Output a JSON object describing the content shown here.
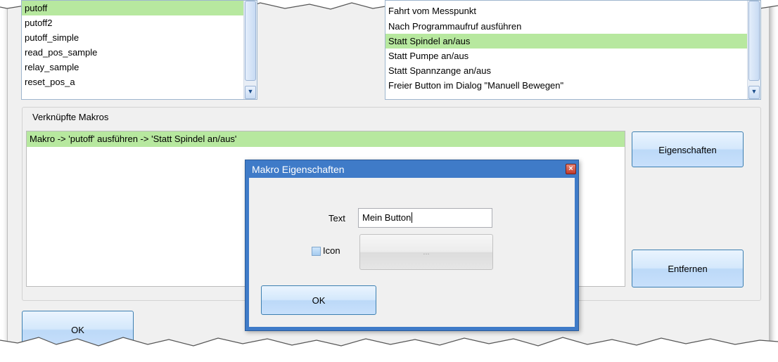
{
  "macro_list": {
    "items": [
      "putoff",
      "putoff2",
      "putoff_simple",
      "read_pos_sample",
      "relay_sample",
      "reset_pos_a"
    ],
    "selected_index": 0
  },
  "action_list": {
    "items": [
      "Fahrt vom Messpunkt",
      "Nach Programmaufruf ausführen",
      "Statt Spindel an/aus",
      "Statt Pumpe an/aus",
      "Statt Spannzange an/aus",
      "Freier Button im Dialog \"Manuell Bewegen\""
    ],
    "selected_index": 2
  },
  "linked_macros": {
    "title": "Verknüpfte Makros",
    "rows": [
      "Makro -> 'putoff' ausführen -> 'Statt Spindel an/aus'"
    ]
  },
  "buttons": {
    "properties": "Eigenschaften",
    "remove": "Entfernen",
    "ok": "OK"
  },
  "dialog": {
    "title": "Makro Eigenschaften",
    "close_glyph": "×",
    "text_label": "Text",
    "text_value": "Mein Button",
    "icon_label": "Icon",
    "icon_checked": false,
    "browse_label": "...",
    "ok": "OK"
  },
  "colors": {
    "selection": "#b7e89f",
    "dialog_frame": "#3f7bc8",
    "button_border": "#3c7fb1"
  }
}
